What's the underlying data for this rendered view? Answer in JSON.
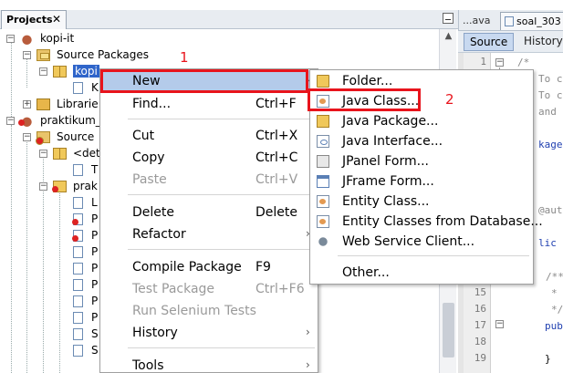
{
  "projects_panel": {
    "tab_label": "Projects",
    "close_glyph": "✕"
  },
  "tree": {
    "kopi_it": "kopi-it",
    "source_packages": "Source Packages",
    "kopi_selected": "kopi",
    "k_file": "K",
    "libraries": "Librarie",
    "praktikum": "praktikum_",
    "source_packages2": "Source",
    "default_pkg": "<det",
    "t_file": "T",
    "prak_pkg": "prak",
    "child_files": [
      "L",
      "P",
      "P",
      "P",
      "P",
      "P",
      "P",
      "P",
      "S",
      "S"
    ]
  },
  "editor": {
    "tab1": "...ava",
    "tab2": "soal_303",
    "source_btn": "Source",
    "history_btn": "History",
    "line_numbers": [
      "1",
      "15",
      "16",
      "17",
      "18",
      "19"
    ],
    "code_lines": [
      "/*",
      "To c",
      "To c",
      "and",
      "kage",
      "@aut",
      "lic",
      "/**",
      "*",
      "*/",
      "pub",
      "}"
    ]
  },
  "context_menu": {
    "new": "New",
    "find": "Find...",
    "find_sc": "Ctrl+F",
    "cut": "Cut",
    "cut_sc": "Ctrl+X",
    "copy": "Copy",
    "copy_sc": "Ctrl+C",
    "paste": "Paste",
    "paste_sc": "Ctrl+V",
    "delete": "Delete",
    "delete_sc": "Delete",
    "refactor": "Refactor",
    "compile": "Compile Package",
    "compile_sc": "F9",
    "test": "Test Package",
    "test_sc": "Ctrl+F6",
    "selenium": "Run Selenium Tests",
    "history": "History",
    "tools": "Tools",
    "arrow": "›"
  },
  "submenu": {
    "folder": "Folder...",
    "java_class": "Java Class...",
    "java_package": "Java Package...",
    "java_interface": "Java Interface...",
    "jpanel": "JPanel Form...",
    "jframe": "JFrame Form...",
    "entity_class": "Entity Class...",
    "entity_db": "Entity Classes from Database...",
    "web_service": "Web Service Client...",
    "other": "Other..."
  },
  "annotations": {
    "step1": "1",
    "step2": "2",
    "color": "#e8141c"
  }
}
